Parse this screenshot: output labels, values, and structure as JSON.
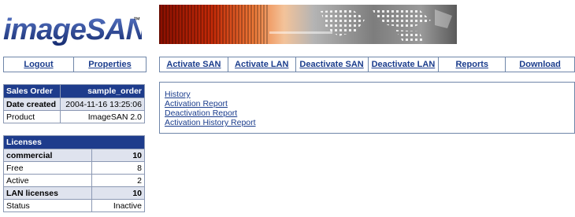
{
  "brand": {
    "logo_part1": "image",
    "logo_part2": "SAN",
    "trademark": "™"
  },
  "left_nav": [
    {
      "label": "Logout"
    },
    {
      "label": "Properties"
    }
  ],
  "main_nav": [
    {
      "label": "Activate SAN"
    },
    {
      "label": "Activate LAN"
    },
    {
      "label": "Deactivate SAN"
    },
    {
      "label": "Deactivate LAN"
    },
    {
      "label": "Reports"
    },
    {
      "label": "Download"
    }
  ],
  "reports_panel": {
    "links": [
      {
        "label": "History"
      },
      {
        "label": "Activation Report"
      },
      {
        "label": "Deactivation Report"
      },
      {
        "label": "Activation History Report"
      }
    ]
  },
  "sales_order": {
    "header": {
      "label": "Sales Order",
      "value": "sample_order"
    },
    "rows": [
      {
        "label": "Date created",
        "value": "2004-11-16 13:25:06"
      },
      {
        "label": "Product",
        "value": "ImageSAN 2.0"
      }
    ]
  },
  "licenses": {
    "header": "Licenses",
    "rows": [
      {
        "label": "commercial",
        "value": "10"
      },
      {
        "label": "Free",
        "value": "8"
      },
      {
        "label": "Active",
        "value": "2"
      },
      {
        "label": "LAN licenses",
        "value": "10"
      },
      {
        "label": "Status",
        "value": "Inactive"
      }
    ]
  },
  "colors": {
    "header_bg": "#1e3c8c",
    "border": "#6f86a9",
    "link": "#1a3c8c",
    "lavender": "#dfe3ee"
  }
}
